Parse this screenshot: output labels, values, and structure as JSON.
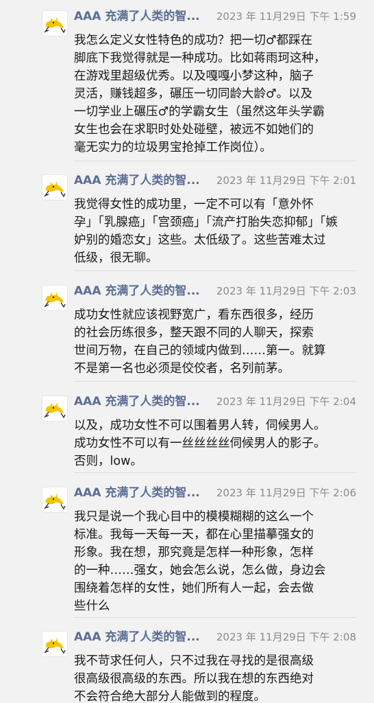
{
  "colors": {
    "background": "#f2f2f2",
    "sender": "#5a6d95",
    "timestamp": "#8a8a8a",
    "text": "#1a1a1a",
    "avatar_bg": "#ffffff",
    "avatar_cat": "#f5c400"
  },
  "messages": [
    {
      "avatar_icon": "yellow-cat-icon",
      "sender": "AAA 充满了人类的智...",
      "time": "2023 年 11月29日  下午 1:59",
      "text": "我怎么定义女性特色的成功？把一切♂都踩在\n脚底下我觉得就是一种成功。比如蒋雨珂这种，\n在游戏里超级优秀。以及嘎嘎小梦这种，脑子\n灵活，赚钱超多，碾压一切同龄大龄♂。以及\n一切学业上碾压♂的学霸女生（虽然这年头学霸\n女生也会在求职时处处碰壁，被远不如她们的\n毫无实力的垃圾男宝抢掉工作岗位）。"
    },
    {
      "avatar_icon": "yellow-cat-icon",
      "sender": "AAA 充满了人类的智...",
      "time": "2023 年 11月29日  下午 2:01",
      "text": "我觉得女性的成功里，一定不可以有「意外怀\n孕」「乳腺癌」「宫颈癌」「流产打胎失恋抑郁」「嫉\n妒别的婚恋女」这些。太低级了。这些苦难太过\n低级，很无聊。"
    },
    {
      "avatar_icon": "yellow-cat-icon",
      "sender": "AAA 充满了人类的智...",
      "time": "2023 年 11月29日  下午 2:03",
      "text": "成功女性就应该视野宽广，看东西很多，经历\n的社会历练很多，整天跟不同的人聊天，探索\n世间万物，在自己的领域内做到……第一。就算\n不是第一名也必须是佼佼者，名列前茅。"
    },
    {
      "avatar_icon": "yellow-cat-icon",
      "sender": "AAA 充满了人类的智...",
      "time": "2023 年 11月29日  下午 2:04",
      "text": "以及，成功女性不可以围着男人转，伺候男人。\n成功女性不可以有一丝丝丝丝伺候男人的影子。\n否则，low。"
    },
    {
      "avatar_icon": "yellow-cat-icon",
      "sender": "AAA 充满了人类的智...",
      "time": "2023 年 11月29日  下午 2:06",
      "text": "我只是说一个我心目中的模模糊糊的这么一个\n标准。我每一天每一天，都在心里描摹强女的\n形象。我在想，那究竟是怎样一种形象，怎样\n的一种……强女，她会怎么说，怎么做，身边会\n围绕着怎样的女性，她们所有人一起，会去做\n些什么"
    },
    {
      "avatar_icon": "yellow-cat-icon",
      "sender": "AAA 充满了人类的智...",
      "time": "2023 年 11月29日  下午 2:08",
      "text": "我不苛求任何人，只不过我在寻找的是很高级\n很高级很高级的东西。所以我在想的东西绝对\n不会符合绝大部分人能做到的程度。"
    }
  ]
}
